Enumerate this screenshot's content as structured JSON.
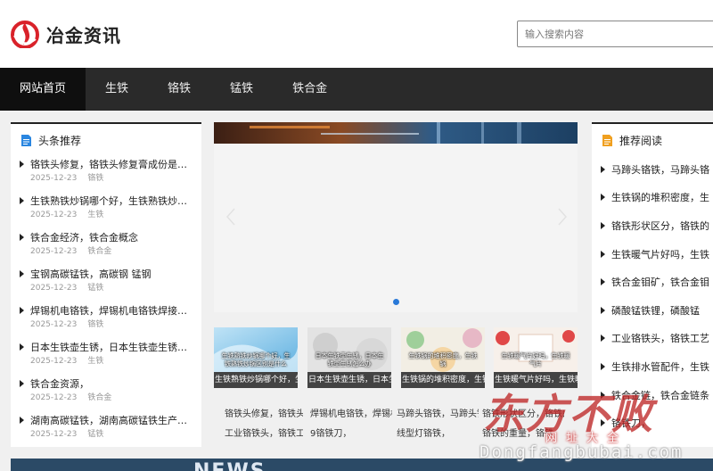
{
  "brand": {
    "name": "冶金资讯",
    "color": "#d9222a"
  },
  "search": {
    "placeholder": "输入搜索内容",
    "value": ""
  },
  "nav": [
    "网站首页",
    "生铁",
    "铬铁",
    "锰铁",
    "铁合金"
  ],
  "left_panel": {
    "title": "头条推荐",
    "items": [
      {
        "title": "铬铁头修复，铬铁头修复膏成份是什么",
        "date": "2025-12-23",
        "tag": "铬铁"
      },
      {
        "title": "生铁熟铁炒锅哪个好，生铁熟铁炒锅区别",
        "date": "2025-12-23",
        "tag": "生铁"
      },
      {
        "title": "铁合金经济，铁合金概念",
        "date": "2025-12-23",
        "tag": "铁合金"
      },
      {
        "title": "宝钢高碳锰铁，高碳钢 锰钢",
        "date": "2025-12-23",
        "tag": "锰铁"
      },
      {
        "title": "焊锡机电铬铁，焊锡机电铬铁焊接方法",
        "date": "2025-12-23",
        "tag": "铬铁"
      },
      {
        "title": "日本生铁壶生锈，日本生铁壶生锈怎么办",
        "date": "2025-12-23",
        "tag": "生铁"
      },
      {
        "title": "铁合金资源，",
        "date": "2025-12-23",
        "tag": "铁合金"
      },
      {
        "title": "湖南高碳锰铁，湖南高碳锰铁生产厂家",
        "date": "2025-12-23",
        "tag": "锰铁"
      }
    ]
  },
  "right_panel": {
    "title": "推荐阅读",
    "items": [
      "马蹄头铬铁，马蹄头铬",
      "生铁锅的堆积密度，生",
      "铬铁形状区分，铬铁的",
      "生铁暖气片好吗，生铁",
      "铁合金钼矿，铁合金钼",
      "磷酸锰铁锂，磷酸锰",
      "工业铬铁头，铬铁工艺",
      "生铁排水管配件，生铁",
      "铁合金链，铁合金链条",
      "铬铁刀，"
    ]
  },
  "thumbs": [
    {
      "overlay": "生铁熟铁炒锅哪个好，生铁熟铁炒锅区别是什么",
      "caption": "生铁熟铁炒锅哪个好，生铁"
    },
    {
      "overlay": "日本生铁壶生锈，日本生铁壶生锈怎么办",
      "caption": "日本生铁壶生锈，日本生铁"
    },
    {
      "overlay": "生铁锅的堆积密度，生铁锅",
      "caption": "生铁锅的堆积密度，生铁锅"
    },
    {
      "overlay": "生铁暖气片好吗，生铁暖气片",
      "caption": "生铁暖气片好吗，生铁暖气片"
    }
  ],
  "bottom_links": [
    [
      "铬铁头修复，铬铁头修复膏",
      "焊锡机电铬铁，焊锡机电铬",
      "马蹄头铬铁，马蹄头铬",
      "铬铁形状区分，铬铁的"
    ],
    [
      "工业铬铁头，铬铁工艺",
      "9铬铁刀，",
      "线型灯铬铁，",
      "铬铁的重量，铬铁"
    ]
  ],
  "banner": {
    "text": "NEWS"
  },
  "watermark": {
    "big": "东方不败",
    "small": "网址大全",
    "url": "Dongfangbubai.com"
  }
}
